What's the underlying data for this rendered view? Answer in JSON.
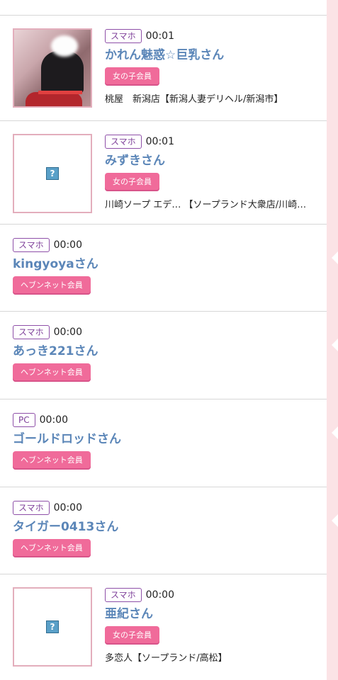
{
  "entries": [
    {
      "device": "スマホ",
      "time": "00:01",
      "name": "かれん魅惑☆巨乳さん",
      "badge": "女の子会員",
      "shop": "桃屋　新潟店【新潟人妻デリヘル/新潟市】",
      "thumb": "photo"
    },
    {
      "device": "スマホ",
      "time": "00:01",
      "name": "みずきさん",
      "badge": "女の子会員",
      "shop": "川崎ソープ エデ… 【ソープランド大衆店/川崎…",
      "thumb": "placeholder"
    },
    {
      "device": "スマホ",
      "time": "00:00",
      "name": "kingyoyaさん",
      "badge": "ヘブンネット会員"
    },
    {
      "device": "スマホ",
      "time": "00:00",
      "name": "あっき221さん",
      "badge": "ヘブンネット会員"
    },
    {
      "device": "PC",
      "time": "00:00",
      "name": "ゴールドロッドさん",
      "badge": "ヘブンネット会員"
    },
    {
      "device": "スマホ",
      "time": "00:00",
      "name": "タイガー0413さん",
      "badge": "ヘブンネット会員"
    },
    {
      "device": "スマホ",
      "time": "00:00",
      "name": "亜紀さん",
      "badge": "女の子会員",
      "shop": "多恋人【ソープランド/高松】",
      "thumb": "placeholder"
    }
  ],
  "placeholder_icon": "?",
  "colors": {
    "accent_pink": "#f06b9a",
    "name_blue": "#5b86b8",
    "device_purple": "#7e3f99",
    "rail_pink": "#fbe3e6"
  }
}
